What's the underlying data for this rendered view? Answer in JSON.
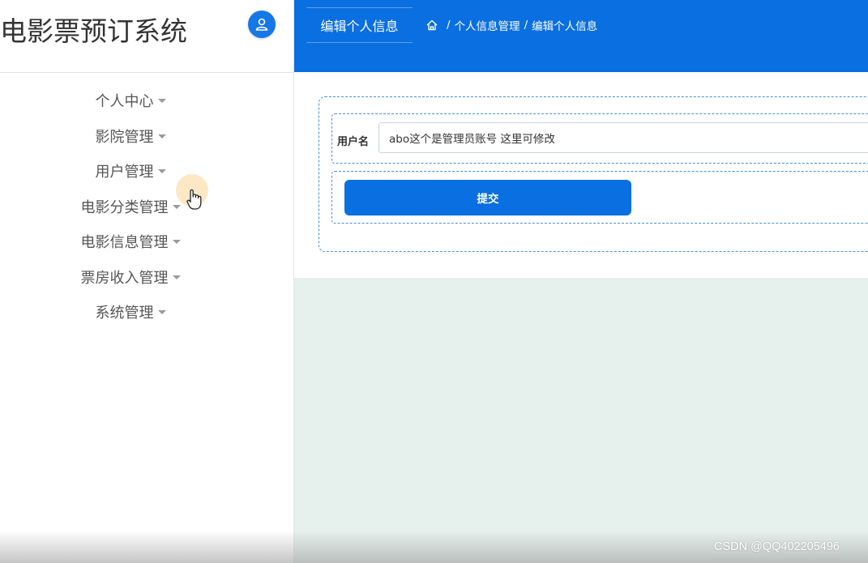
{
  "app": {
    "title": "电影票预订系统"
  },
  "sidebar": {
    "items": [
      {
        "label": "个人中心"
      },
      {
        "label": "影院管理"
      },
      {
        "label": "用户管理"
      },
      {
        "label": "电影分类管理"
      },
      {
        "label": "电影信息管理"
      },
      {
        "label": "票房收入管理"
      },
      {
        "label": "系统管理"
      }
    ]
  },
  "header": {
    "page_tab": "编辑个人信息",
    "breadcrumb": [
      "个人信息管理",
      "编辑个人信息"
    ]
  },
  "form": {
    "username_label": "用户名",
    "username_value": "abo这个是管理员账号 这里可修改",
    "submit_label": "提交"
  },
  "watermark": "CSDN @QQ402205496",
  "colors": {
    "primary": "#0a6fe0",
    "content_background": "#e6f0ec",
    "dashed_border": "#4b8fd6"
  },
  "icons": {
    "avatar": "user-icon",
    "home": "home-icon",
    "menu_caret": "caret-down-icon",
    "cursor": "hand-pointer-icon"
  }
}
